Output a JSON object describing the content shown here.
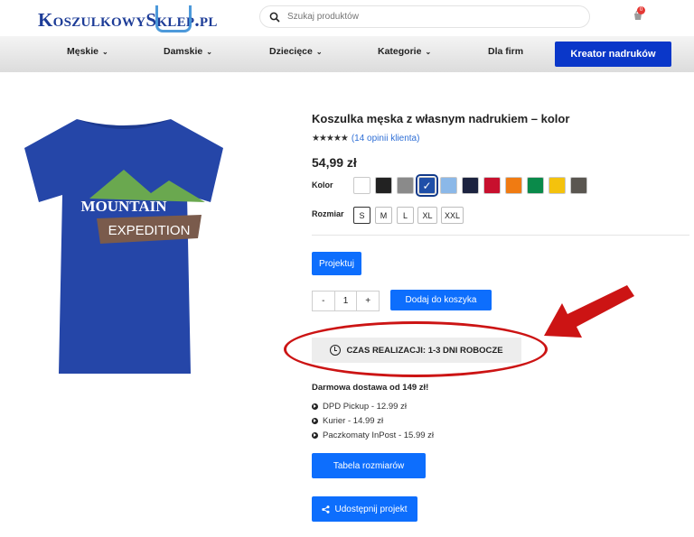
{
  "header": {
    "logo_text": "KoszulkowySklep.pl",
    "search_placeholder": "Szukaj produktów",
    "cart_count": "0"
  },
  "nav": {
    "items": [
      "Męskie",
      "Damskie",
      "Dziecięce",
      "Kategorie",
      "Dla firm"
    ],
    "cta": "Kreator nadruków"
  },
  "product": {
    "title": "Koszulka męska z własnym nadrukiem – kolor",
    "stars": "★★★★★",
    "reviews": "(14 opinii klienta)",
    "price": "54,99 zł",
    "color_label": "Kolor",
    "colors": [
      "#ffffff",
      "#222222",
      "#8a8a8a",
      "#1f4fa8",
      "#8bb8e8",
      "#1c2340",
      "#c8102e",
      "#f07b12",
      "#0a8a4a",
      "#f4c20d",
      "#5a5650"
    ],
    "selected_color_index": 3,
    "size_label": "Rozmiar",
    "sizes": [
      "S",
      "M",
      "L",
      "XL",
      "XXL"
    ],
    "selected_size": "S",
    "design_button": "Projektuj",
    "qty_minus": "-",
    "qty_value": "1",
    "qty_plus": "+",
    "add_to_cart": "Dodaj do koszyka",
    "realization": "CZAS REALIZACJI: 1-3 DNI ROBOCZE",
    "shirt_text_top": "MOUNTAIN",
    "shirt_text_bottom": "EXPEDITION"
  },
  "delivery": {
    "title": "Darmowa dostawa od 149 zł!",
    "options": [
      "DPD Pickup - 12.99 zł",
      "Kurier - 14.99 zł",
      "Paczkomaty InPost - 15.99 zł"
    ]
  },
  "buttons": {
    "size_table": "Tabela rozmiarów",
    "share": "Udostępnij projekt"
  }
}
